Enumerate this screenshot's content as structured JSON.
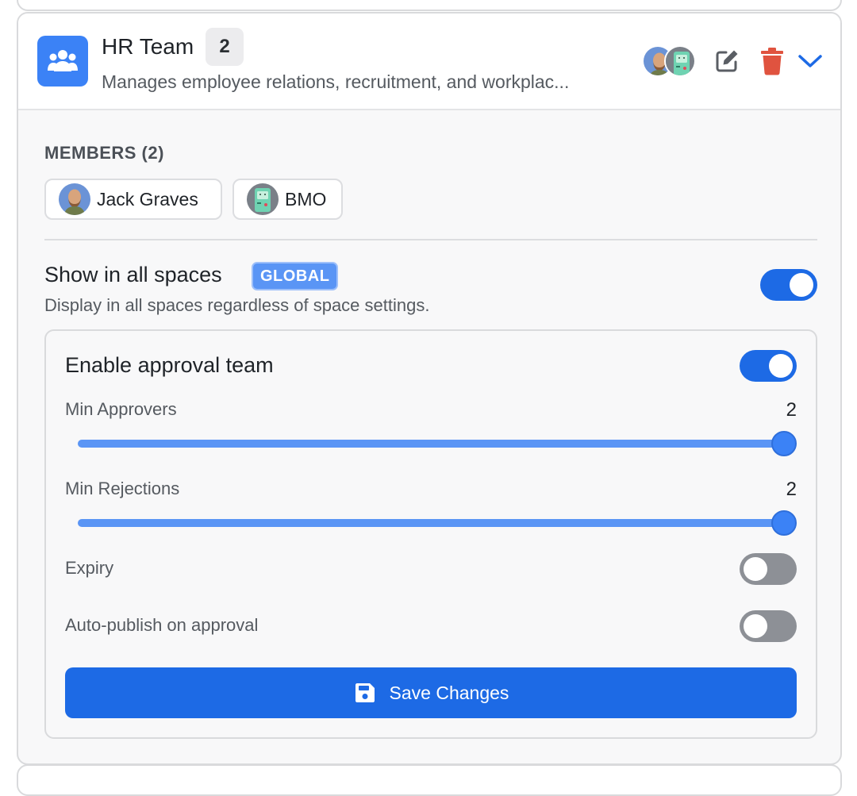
{
  "team": {
    "name": "HR Team",
    "member_count": "2",
    "description": "Manages employee relations, recruitment, and workplac...",
    "icon": "users-icon"
  },
  "header_actions": {
    "edit_icon": "edit-icon",
    "delete_icon": "trash-icon",
    "expand_icon": "chevron-down-icon"
  },
  "members": {
    "section_label": "MEMBERS (2)",
    "items": [
      {
        "name": "Jack Graves"
      },
      {
        "name": "BMO"
      }
    ]
  },
  "global": {
    "title": "Show in all spaces",
    "badge": "GLOBAL",
    "description": "Display in all spaces regardless of space settings.",
    "enabled": true
  },
  "approval": {
    "title": "Enable approval team",
    "enabled": true,
    "min_approvers": {
      "label": "Min Approvers",
      "value": "2",
      "fraction": 1.0
    },
    "min_rejections": {
      "label": "Min Rejections",
      "value": "2",
      "fraction": 1.0
    },
    "expiry": {
      "label": "Expiry",
      "enabled": false
    },
    "auto_publish": {
      "label": "Auto-publish on approval",
      "enabled": false
    },
    "save_label": "Save Changes"
  },
  "colors": {
    "primary": "#1d6ae5",
    "delete": "#e0533f",
    "team_icon_bg": "#3b82f6",
    "toggle_off": "#8d9096"
  }
}
